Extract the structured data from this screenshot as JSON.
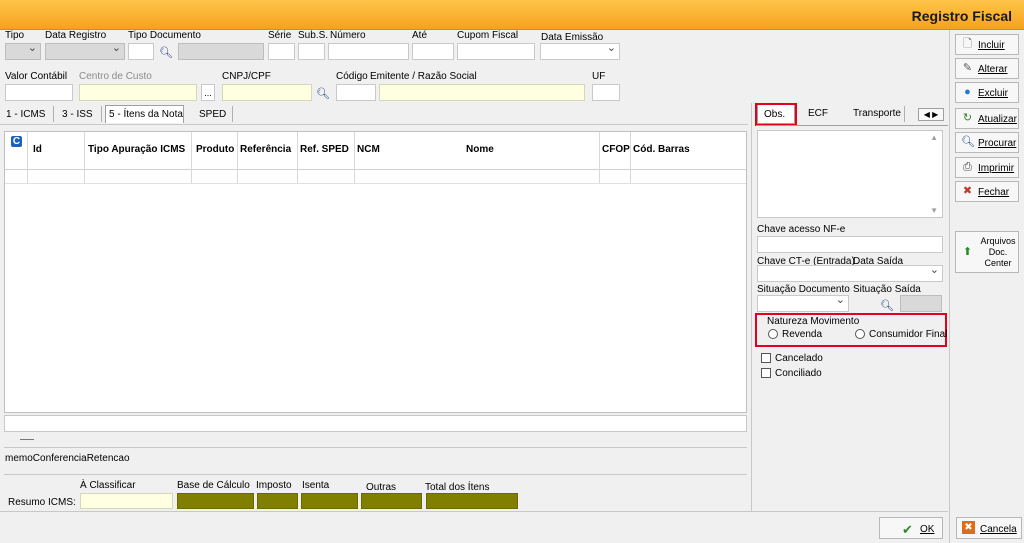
{
  "window": {
    "title": "Registro Fiscal"
  },
  "filters": {
    "tipo_label": "Tipo",
    "data_registro_label": "Data Registro",
    "tipo_documento_label": "Tipo Documento",
    "serie_label": "Série",
    "subserie_label": "Sub.S.",
    "numero_label": "Número",
    "ate_label": "Até",
    "cupom_fiscal_label": "Cupom Fiscal",
    "data_emissao_label": "Data Emissão",
    "valor_contabil_label": "Valor Contábil",
    "centro_custo_label": "Centro de Custo",
    "centro_custo_button": "...",
    "cnpj_label": "CNPJ/CPF",
    "codigo_label": "Código",
    "emitente_label": "Emitente / Razão Social",
    "uf_label": "UF"
  },
  "left_tabs": [
    "1 - ICMS",
    "3 - ISS",
    "5 - Ítens da Nota",
    "SPED"
  ],
  "right_tabs": [
    "Obs.",
    "ECF",
    "Transporte"
  ],
  "grid": {
    "badge": "C",
    "columns": [
      "Id",
      "Tipo Apuração ICMS",
      "Produto",
      "Referência",
      "Ref. SPED",
      "NCM",
      "Nome",
      "CFOP",
      "Cód. Barras"
    ]
  },
  "memo_label": "memoConferenciaRetencao",
  "right_panel": {
    "chave_acesso_label": "Chave acesso NF-e",
    "chave_cte_label": "Chave CT-e (Entrada)",
    "data_saida_label": "Data Saída",
    "situacao_documento_label": "Situação Documento",
    "situacao_saida_label": "Situação Saída",
    "natureza_label": "Natureza Movimento",
    "revenda_label": "Revenda",
    "consumidor_final_label": "Consumidor Final",
    "cancelado_label": "Cancelado",
    "conciliado_label": "Conciliado"
  },
  "summary": {
    "resumo_label": "Resumo ICMS:",
    "a_classificar_label": "À Classificar",
    "base_calculo_label": "Base de Cálculo",
    "imposto_label": "Imposto",
    "isenta_label": "Isenta",
    "outras_label": "Outras",
    "total_itens_label": "Total dos Ítens"
  },
  "toolbar": {
    "incluir": "Incluir",
    "alterar": "Alterar",
    "excluir": "Excluir",
    "atualizar": "Atualizar",
    "procurar": "Procurar",
    "imprimir": "Imprimir",
    "fechar": "Fechar",
    "arquivos": "Arquivos Doc. Center"
  },
  "footer": {
    "ok": "OK",
    "cancela": "Cancela"
  }
}
